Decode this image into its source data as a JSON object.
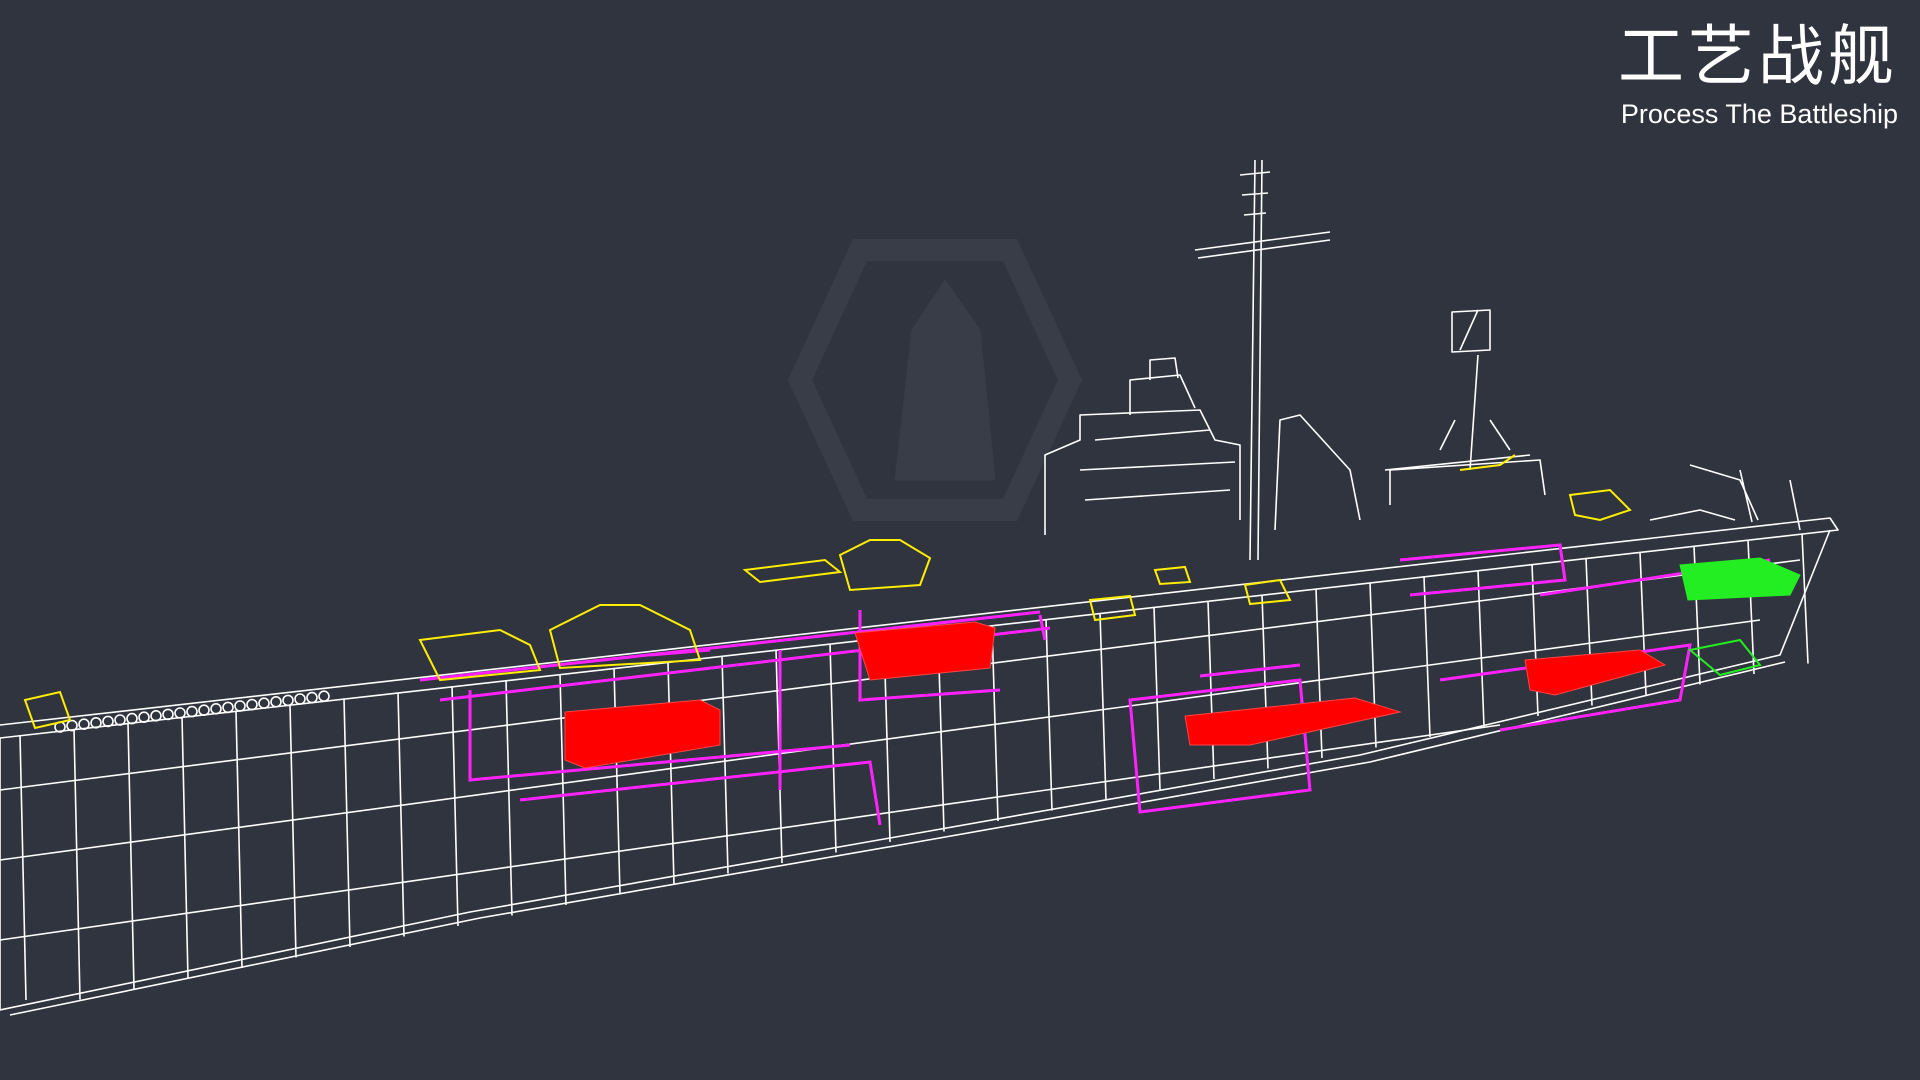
{
  "title": {
    "cn": "工艺战舰",
    "en": "Process The Battleship"
  },
  "colors": {
    "background": "#30343e",
    "structure": "#ffffff",
    "deck_equipment": "#ffee00",
    "piping": "#ff22ff",
    "tanks": "#ff0000",
    "stern_section": "#22ee22"
  },
  "watermark_icon": "lighthouse-hexagon-icon"
}
